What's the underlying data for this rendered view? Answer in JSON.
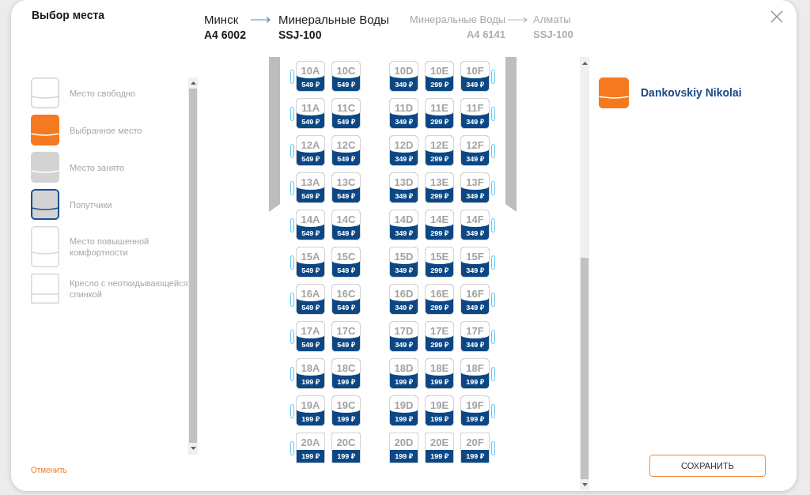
{
  "dialog": {
    "title": "Выбор места"
  },
  "route": {
    "segments": [
      {
        "from": "Минск",
        "flight": "A4 6002",
        "to": "Минеральные Воды",
        "aircraft": "SSJ-100",
        "selected": true
      },
      {
        "from": "Минеральные Воды",
        "flight": "A4 6141",
        "to": "Алматы",
        "aircraft": "SSJ-100",
        "selected": false
      }
    ]
  },
  "legend": {
    "items": [
      {
        "kind": "free",
        "label": "Место свободно"
      },
      {
        "kind": "selected",
        "label": "Выбранное место"
      },
      {
        "kind": "occupied",
        "label": "Место занято"
      },
      {
        "kind": "companion",
        "label": "Попутчики"
      },
      {
        "kind": "comfort",
        "label": "Место повышенной комфортности"
      },
      {
        "kind": "fixed_back",
        "label": "Кресло с неоткидывающейся спинкой"
      }
    ]
  },
  "cancel_link": "Отменить",
  "seat_map": {
    "rows": [
      {
        "left": [
          {
            "label": "10A",
            "price": "549 ₽",
            "kind": "standard",
            "selected": false
          },
          {
            "label": "10C",
            "price": "549 ₽",
            "kind": "standard",
            "selected": false
          }
        ],
        "right": [
          {
            "label": "10D",
            "price": "349 ₽",
            "kind": "standard",
            "selected": false
          },
          {
            "label": "10E",
            "price": "299 ₽",
            "kind": "standard",
            "selected": false
          },
          {
            "label": "10F",
            "price": "349 ₽",
            "kind": "standard",
            "selected": false
          }
        ]
      },
      {
        "left": [
          {
            "label": "11A",
            "price": "549 ₽",
            "kind": "standard",
            "selected": false
          },
          {
            "label": "11C",
            "price": "549 ₽",
            "kind": "standard",
            "selected": false
          }
        ],
        "right": [
          {
            "label": "11D",
            "price": "349 ₽",
            "kind": "standard",
            "selected": false
          },
          {
            "label": "11E",
            "price": "299 ₽",
            "kind": "standard",
            "selected": false
          },
          {
            "label": "11F",
            "price": "349 ₽",
            "kind": "standard",
            "selected": false
          }
        ]
      },
      {
        "left": [
          {
            "label": "12A",
            "price": "549 ₽",
            "kind": "standard",
            "selected": false
          },
          {
            "label": "12C",
            "price": "549 ₽",
            "kind": "standard",
            "selected": false
          }
        ],
        "right": [
          {
            "label": "12D",
            "price": "349 ₽",
            "kind": "standard",
            "selected": false
          },
          {
            "label": "12E",
            "price": "299 ₽",
            "kind": "standard",
            "selected": false
          },
          {
            "label": "12F",
            "price": "349 ₽",
            "kind": "standard",
            "selected": false
          }
        ]
      },
      {
        "left": [
          {
            "label": "13A",
            "price": "549 ₽",
            "kind": "standard",
            "selected": false
          },
          {
            "label": "13C",
            "price": "549 ₽",
            "kind": "standard",
            "selected": false
          }
        ],
        "right": [
          {
            "label": "13D",
            "price": "349 ₽",
            "kind": "standard",
            "selected": false
          },
          {
            "label": "13E",
            "price": "299 ₽",
            "kind": "standard",
            "selected": false
          },
          {
            "label": "13F",
            "price": "349 ₽",
            "kind": "standard",
            "selected": false
          }
        ]
      },
      {
        "left": [
          {
            "label": "14A",
            "price": "549 ₽",
            "kind": "standard",
            "selected": false
          },
          {
            "label": "14C",
            "price": "549 ₽",
            "kind": "standard",
            "selected": false
          }
        ],
        "right": [
          {
            "label": "14D",
            "price": "349 ₽",
            "kind": "standard",
            "selected": false
          },
          {
            "label": "14E",
            "price": "299 ₽",
            "kind": "standard",
            "selected": false
          },
          {
            "label": "14F",
            "price": "349 ₽",
            "kind": "standard",
            "selected": false
          }
        ]
      },
      {
        "left": [
          {
            "label": "15A",
            "price": "549 ₽",
            "kind": "standard",
            "selected": false
          },
          {
            "label": "15C",
            "price": "549 ₽",
            "kind": "standard",
            "selected": false
          }
        ],
        "right": [
          {
            "label": "15D",
            "price": "349 ₽",
            "kind": "standard",
            "selected": false
          },
          {
            "label": "15E",
            "price": "299 ₽",
            "kind": "standard",
            "selected": false
          },
          {
            "label": "15F",
            "price": "349 ₽",
            "kind": "standard",
            "selected": false
          }
        ]
      },
      {
        "left": [
          {
            "label": "16A",
            "price": "549 ₽",
            "kind": "standard",
            "selected": false
          },
          {
            "label": "16C",
            "price": "549 ₽",
            "kind": "standard",
            "selected": false
          }
        ],
        "right": [
          {
            "label": "16D",
            "price": "349 ₽",
            "kind": "standard",
            "selected": false
          },
          {
            "label": "16E",
            "price": "299 ₽",
            "kind": "standard",
            "selected": false
          },
          {
            "label": "16F",
            "price": "349 ₽",
            "kind": "standard",
            "selected": false
          }
        ]
      },
      {
        "left": [
          {
            "label": "17A",
            "price": "549 ₽",
            "kind": "standard",
            "selected": false
          },
          {
            "label": "17C",
            "price": "549 ₽",
            "kind": "standard",
            "selected": false
          }
        ],
        "right": [
          {
            "label": "17D",
            "price": "349 ₽",
            "kind": "standard",
            "selected": false
          },
          {
            "label": "17E",
            "price": "299 ₽",
            "kind": "standard",
            "selected": false
          },
          {
            "label": "17F",
            "price": "349 ₽",
            "kind": "standard",
            "selected": false
          }
        ]
      },
      {
        "left": [
          {
            "label": "18A",
            "price": "199 ₽",
            "kind": "standard",
            "selected": false
          },
          {
            "label": "18C",
            "price": "199 ₽",
            "kind": "standard",
            "selected": false
          }
        ],
        "right": [
          {
            "label": "18D",
            "price": "199 ₽",
            "kind": "standard",
            "selected": false
          },
          {
            "label": "18E",
            "price": "199 ₽",
            "kind": "standard",
            "selected": false
          },
          {
            "label": "18F",
            "price": "199 ₽",
            "kind": "standard",
            "selected": false
          }
        ]
      },
      {
        "left": [
          {
            "label": "19A",
            "price": "199 ₽",
            "kind": "standard",
            "selected": false
          },
          {
            "label": "19C",
            "price": "199 ₽",
            "kind": "standard",
            "selected": false
          }
        ],
        "right": [
          {
            "label": "19D",
            "price": "199 ₽",
            "kind": "standard",
            "selected": false
          },
          {
            "label": "19E",
            "price": "199 ₽",
            "kind": "standard",
            "selected": false
          },
          {
            "label": "19F",
            "price": "199 ₽",
            "kind": "standard",
            "selected": false
          }
        ]
      },
      {
        "left": [
          {
            "label": "20A",
            "price": "199 ₽",
            "kind": "fixed_back",
            "selected": false
          },
          {
            "label": "20C",
            "price": "199 ₽",
            "kind": "fixed_back",
            "selected": false
          }
        ],
        "right": [
          {
            "label": "20D",
            "price": "199 ₽",
            "kind": "fixed_back",
            "selected": false
          },
          {
            "label": "20E",
            "price": "199 ₽",
            "kind": "fixed_back",
            "selected": false
          },
          {
            "label": "20F",
            "price": "199 ₽",
            "kind": "fixed_back",
            "selected": false
          }
        ]
      }
    ]
  },
  "passengers": [
    {
      "name": "Dankovskiy Nikolai",
      "selected": true
    }
  ],
  "save_button": "СОХРАНИТЬ"
}
